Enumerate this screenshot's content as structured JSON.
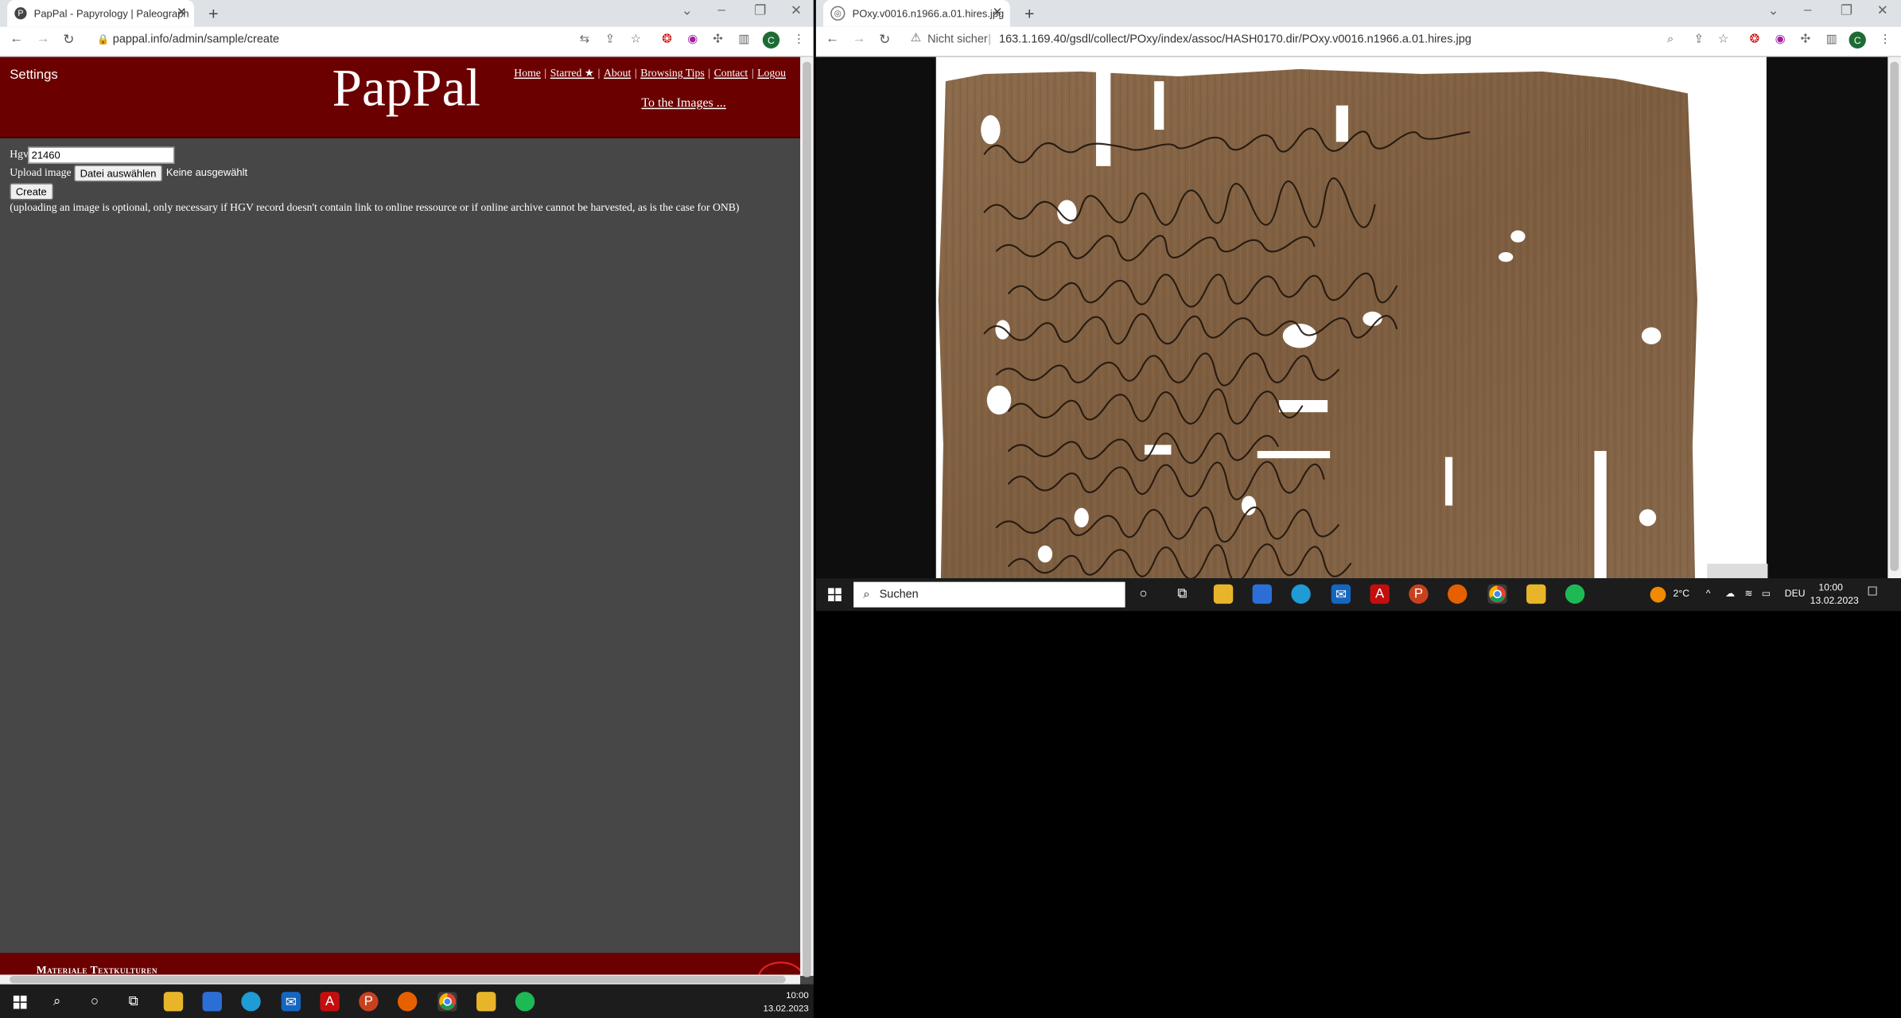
{
  "left_browser": {
    "tab_title": "PapPal - Papyrology | Paleograph",
    "url": "pappal.info/admin/sample/create",
    "profile_initial": "C"
  },
  "page": {
    "settings": "Settings",
    "logo": "PapPal",
    "nav": [
      "Home",
      "Starred ★",
      "About",
      "Browsing Tips",
      "Contact",
      "Logou"
    ],
    "to_images": "To the Images ...",
    "form": {
      "hgv_label": "Hgv",
      "hgv_value": "21460",
      "upload_label": "Upload image",
      "choose_file": "Datei auswählen",
      "no_file": "Keine ausgewählt",
      "create": "Create",
      "note": "(uploading an image is optional, only necessary if HGV record doesn't contain link to online ressource or if online archive cannot be harvested, as is the case for ONB)"
    },
    "footer": "Materiale Textkulturen"
  },
  "right_browser": {
    "tab_title": "POxy.v0016.n1966.a.01.hires.jpg",
    "security": "Nicht sicher",
    "url": "163.1.169.40/gsdl/collect/POxy/index/assoc/HASH0170.dir/POxy.v0016.n1966.a.01.hires.jpg",
    "profile_initial": "C"
  },
  "taskbar_right": {
    "search": "Suchen",
    "temperature": "2°C",
    "language": "DEU",
    "time": "10:00",
    "date": "13.02.2023"
  },
  "taskbar_left": {
    "time": "10:00",
    "date": "13.02.2023"
  },
  "colors": {
    "header_bg": "#6b0000",
    "page_bg": "#474747",
    "papyrus": "#8a6a4a"
  }
}
